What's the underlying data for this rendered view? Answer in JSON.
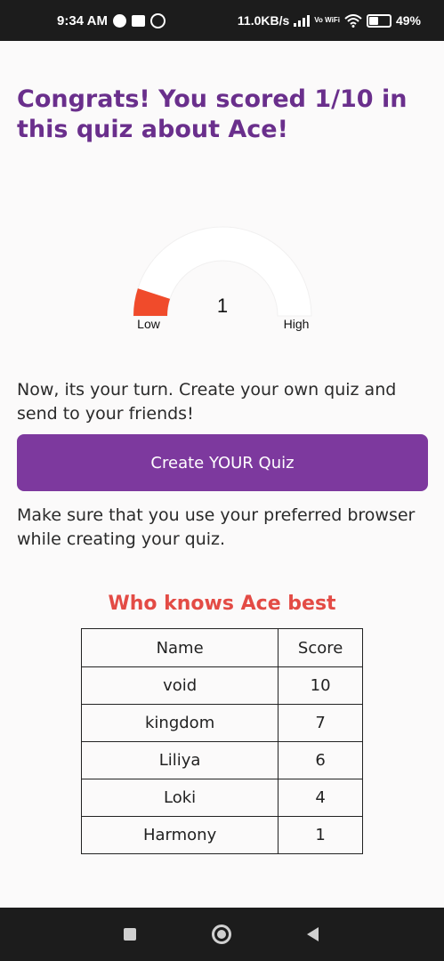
{
  "status_bar": {
    "time": "9:34 AM",
    "left_icons": [
      "spotify-icon",
      "message-icon",
      "whatsapp-icon"
    ],
    "network_speed": "11.0KB/s",
    "volte_label": "Vo WiFi",
    "battery": "49%",
    "battery_level": 0.49
  },
  "result": {
    "headline": "Congrats! You scored 1/10 in this quiz about Ace!",
    "headline_color": "#6a2f8c"
  },
  "gauge": {
    "value": "1",
    "score": 1,
    "max": 10,
    "low_label": "Low",
    "high_label": "High",
    "fill_color": "#f04b2b"
  },
  "promo": {
    "text": "Now, its your turn. Create your own quiz and send to your friends!",
    "button_label": "Create YOUR Quiz",
    "button_color": "#7d399e",
    "note": "Make sure that you use your preferred browser while creating your quiz."
  },
  "leaderboard": {
    "title": "Who knows Ace best",
    "title_color": "#e34b45",
    "columns": [
      "Name",
      "Score"
    ],
    "rows": [
      {
        "name": "void",
        "score": "10"
      },
      {
        "name": "kingdom",
        "score": "7"
      },
      {
        "name": "Liliya",
        "score": "6"
      },
      {
        "name": "Loki",
        "score": "4"
      },
      {
        "name": "Harmony",
        "score": "1"
      }
    ]
  },
  "nav_bar": {
    "icons": [
      "recents-icon",
      "home-icon",
      "back-icon"
    ]
  }
}
